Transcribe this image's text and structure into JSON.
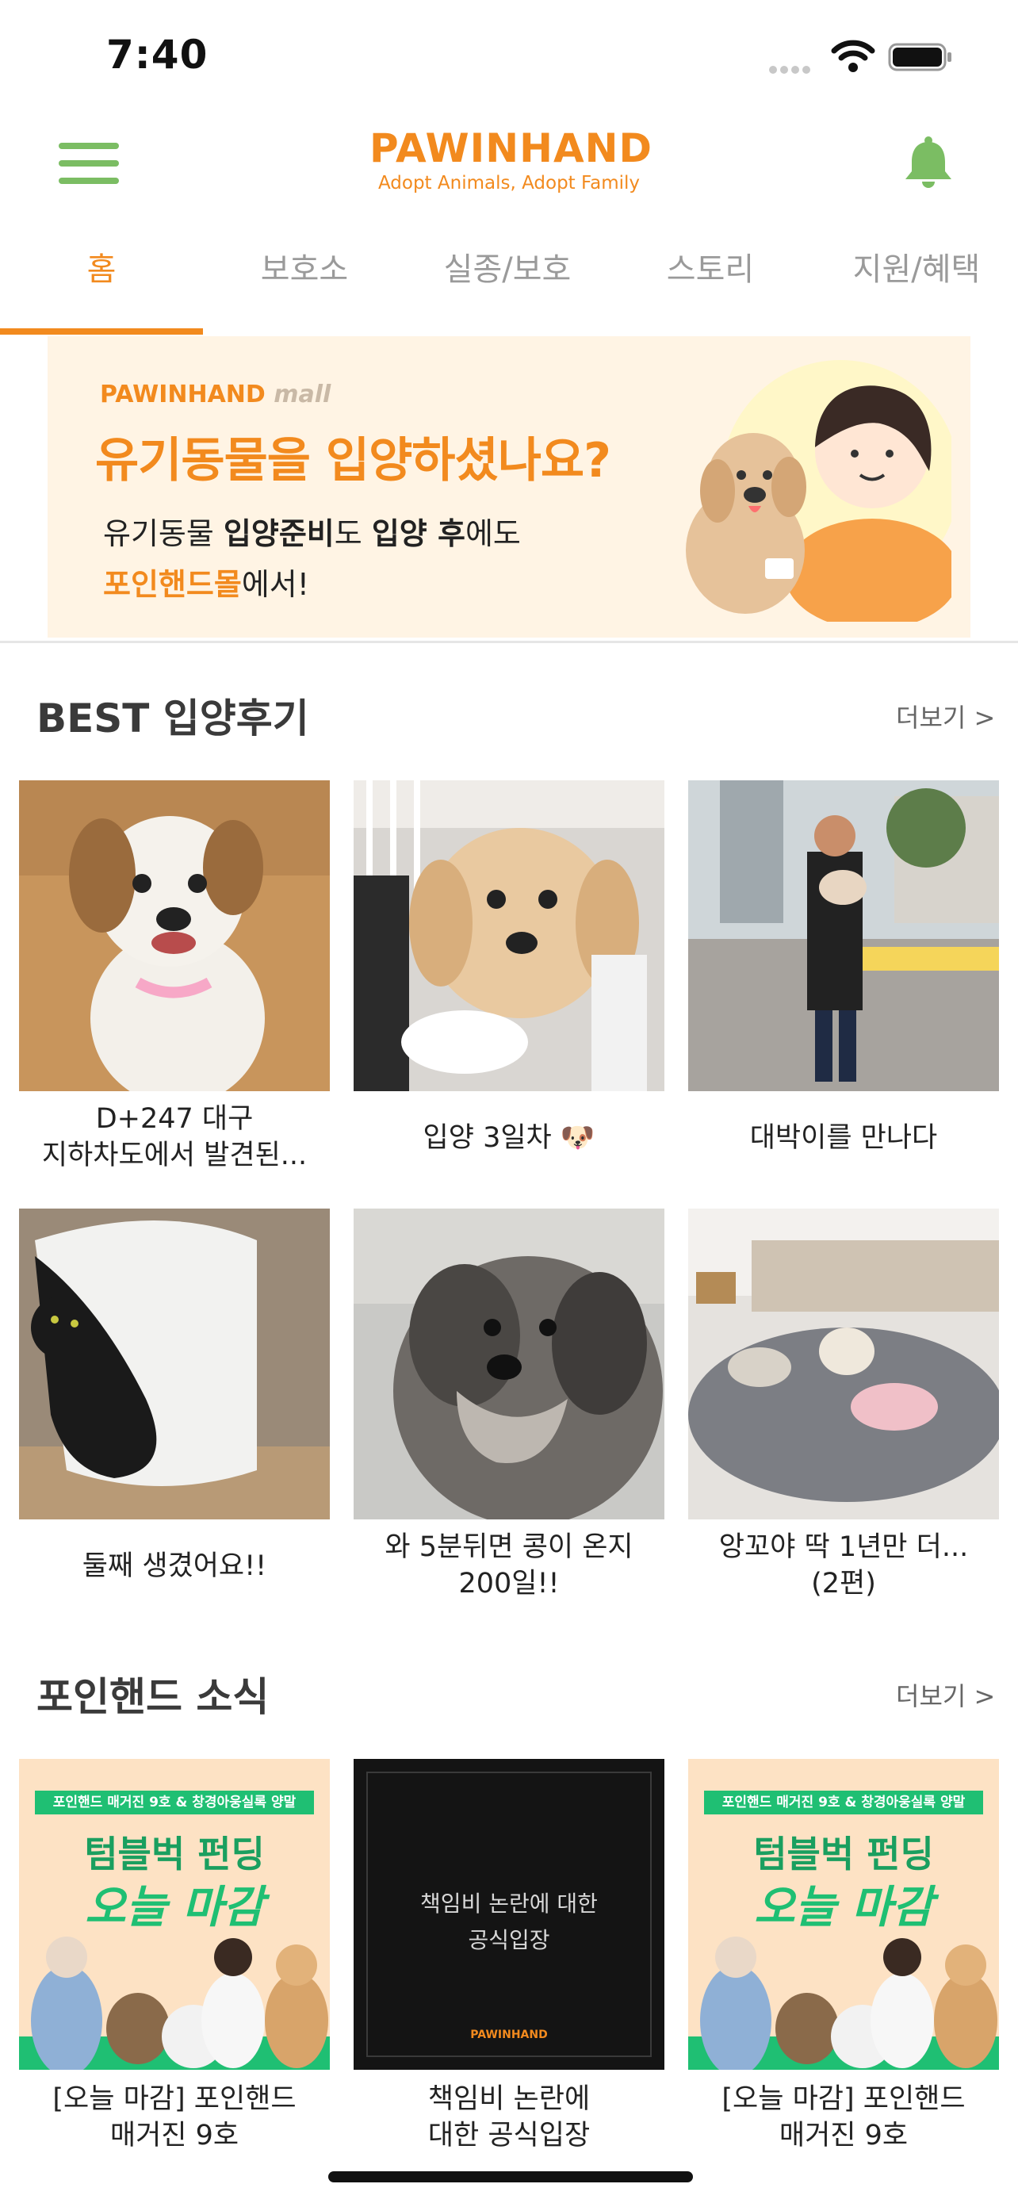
{
  "status_bar": {
    "time": "7:40"
  },
  "header": {
    "logo_title": "PAWINHAND",
    "logo_subtitle": "Adopt Animals, Adopt Family"
  },
  "tabs": [
    {
      "label": "홈",
      "active": true
    },
    {
      "label": "보호소",
      "active": false
    },
    {
      "label": "실종/보호",
      "active": false
    },
    {
      "label": "스토리",
      "active": false
    },
    {
      "label": "지원/혜택",
      "active": false
    }
  ],
  "banner": {
    "brand": "PAWINHAND",
    "brand_suffix": "mall",
    "headline": "유기동물을 입양하셨나요?",
    "line1_a": "유기동물 ",
    "line1_b": "입양준비",
    "line1_c": "도 ",
    "line1_d": "입양 후",
    "line1_e": "에도",
    "line2_a": "포인핸드몰",
    "line2_b": "에서!"
  },
  "best_reviews": {
    "title": "BEST 입양후기",
    "more": "더보기 >",
    "items": [
      {
        "caption_line1": "D+247 대구",
        "caption_line2": "지하차도에서 발견된..."
      },
      {
        "caption_line1": "입양 3일차 🐶",
        "caption_line2": ""
      },
      {
        "caption_line1": "대박이를 만나다",
        "caption_line2": ""
      },
      {
        "caption_line1": "둘째 생겼어요!!",
        "caption_line2": ""
      },
      {
        "caption_line1": "와 5분뒤면 콩이 온지",
        "caption_line2": "200일!!"
      },
      {
        "caption_line1": "앙꼬야 딱 1년만 더...",
        "caption_line2": "(2편)"
      }
    ]
  },
  "news": {
    "title": "포인핸드 소식",
    "more": "더보기 >",
    "items": [
      {
        "caption_line1": "[오늘 마감] 포인핸드",
        "caption_line2": "매거진 9호",
        "img_tag": "포인핸드 매거진 9호 & 창경아웅실록 양말",
        "img_line1": "텀블벅 펀딩",
        "img_line2": "오늘 마감"
      },
      {
        "caption_line1": "책임비 논란에",
        "caption_line2": "대한 공식입장",
        "img_line1": "책임비 논란에 대한",
        "img_line2": "공식입장",
        "img_brand": "PAWINHAND"
      },
      {
        "caption_line1": "[오늘 마감] 포인핸드",
        "caption_line2": "매거진 9호",
        "img_tag": "포인핸드 매거진 9호 & 창경아웅실록 양말",
        "img_line1": "텀블벅 펀딩",
        "img_line2": "오늘 마감"
      }
    ]
  },
  "colors": {
    "accent": "#f28a1e",
    "menu_green": "#7bbd63",
    "banner_bg": "#fff4e4",
    "promo_green": "#1fbf73"
  }
}
